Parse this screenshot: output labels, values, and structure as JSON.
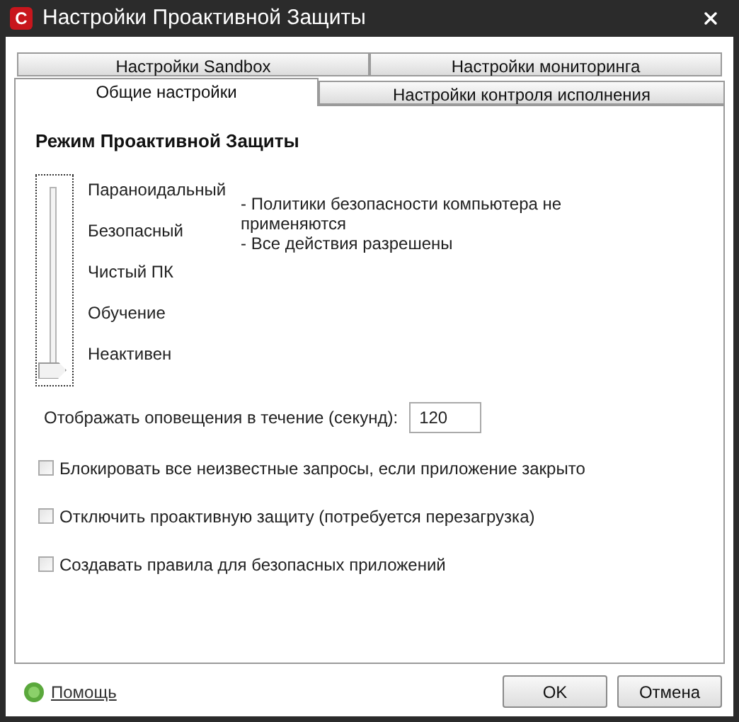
{
  "window": {
    "logo": "C",
    "title": "Настройки Проактивной Защиты"
  },
  "tab_rows": [
    [
      {
        "label": "Настройки Sandbox",
        "selected": false
      },
      {
        "label": "Настройки мониторинга",
        "selected": false
      }
    ],
    [
      {
        "label": "Общие настройки",
        "selected": true
      },
      {
        "label": "Настройки контроля исполнения",
        "selected": false
      }
    ]
  ],
  "section_title": "Режим Проактивной Защиты",
  "slider": {
    "level": 0,
    "labels": [
      "Параноидальный",
      "Безопасный",
      "Чистый ПК",
      "Обучение",
      "Неактивен"
    ]
  },
  "description": [
    "- Политики безопасности компьютера не применяются",
    "- Все действия разрешены"
  ],
  "alert_duration": {
    "label": "Отображать оповещения в течение (секунд):",
    "value": "120"
  },
  "options": [
    {
      "label": "Блокировать все неизвестные запросы, если приложение закрыто",
      "checked": false
    },
    {
      "label": "Отключить проактивную защиту (потребуется перезагрузка)",
      "checked": false
    },
    {
      "label": "Создавать правила для безопасных приложений",
      "checked": false
    }
  ],
  "help_link": "Помощь",
  "buttons": [
    "OK",
    "Отмена"
  ]
}
